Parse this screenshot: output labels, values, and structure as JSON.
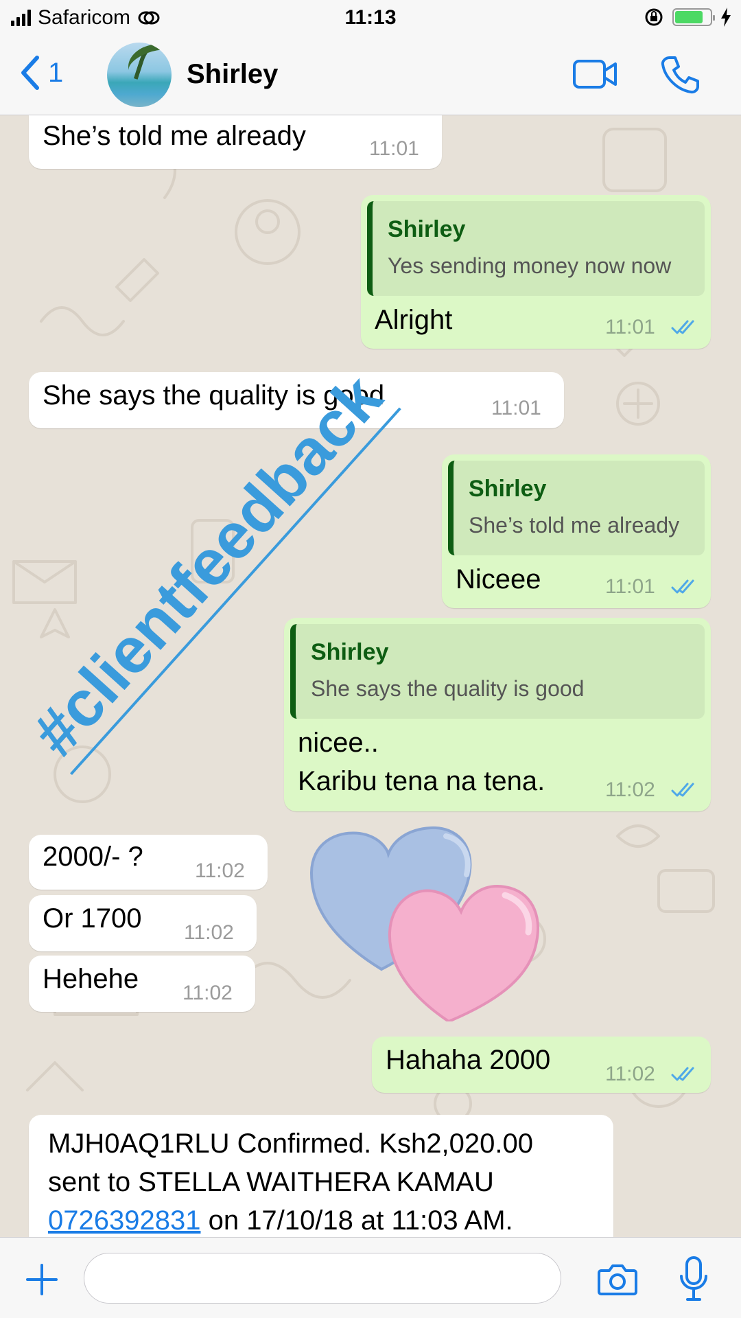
{
  "status_bar": {
    "carrier": "Safaricom",
    "time": "11:13",
    "battery_level": 0.8
  },
  "header": {
    "back_count": "1",
    "contact_name": "Shirley",
    "icons": [
      "back-chevron-icon",
      "video-call-icon",
      "phone-call-icon"
    ]
  },
  "messages": [
    {
      "direction": "incoming",
      "text": "She’s told me already",
      "time": "11:01"
    },
    {
      "direction": "outgoing",
      "quote_author": "Shirley",
      "quote_text": "Yes sending money now now",
      "text": "Alright",
      "time": "11:01",
      "status": "read"
    },
    {
      "direction": "incoming",
      "text": "She says the quality is good",
      "time": "11:01"
    },
    {
      "direction": "outgoing",
      "quote_author": "Shirley",
      "quote_text": "She’s told me already",
      "text": "Niceee",
      "time": "11:01",
      "status": "read"
    },
    {
      "direction": "outgoing",
      "quote_author": "Shirley",
      "quote_text": "She says the quality is good",
      "text_line1": "nicee..",
      "text_line2": "Karibu tena na tena.",
      "time": "11:02",
      "status": "read"
    },
    {
      "direction": "incoming",
      "text": "2000/- ?",
      "time": "11:02"
    },
    {
      "direction": "incoming",
      "text": "Or 1700",
      "time": "11:02"
    },
    {
      "direction": "incoming",
      "text": "Hehehe",
      "time": "11:02"
    },
    {
      "direction": "incoming",
      "type": "sticker",
      "sticker": "two-hearts-sticker"
    },
    {
      "direction": "outgoing",
      "text": "Hahaha 2000",
      "time": "11:02",
      "status": "read"
    },
    {
      "direction": "incoming",
      "line1": "MJH0AQ1RLU Confirmed. Ksh2,020.00",
      "line2": "sent to STELLA WAITHERA KAMAU",
      "phone": "0726392831",
      "line3_rest": " on 17/10/18 at 11:03 AM."
    }
  ],
  "watermark": "#clientfeedback",
  "input_bar": {
    "placeholder": "",
    "icons": [
      "plus-icon",
      "camera-icon",
      "microphone-icon"
    ]
  },
  "colors": {
    "accent": "#1a7ce6",
    "outgoing_bubble": "#dcf8c6",
    "incoming_bubble": "#ffffff",
    "quote_author": "#0e5d13",
    "read_ticks": "#4fa8e8",
    "watermark": "#3a9bdc"
  }
}
